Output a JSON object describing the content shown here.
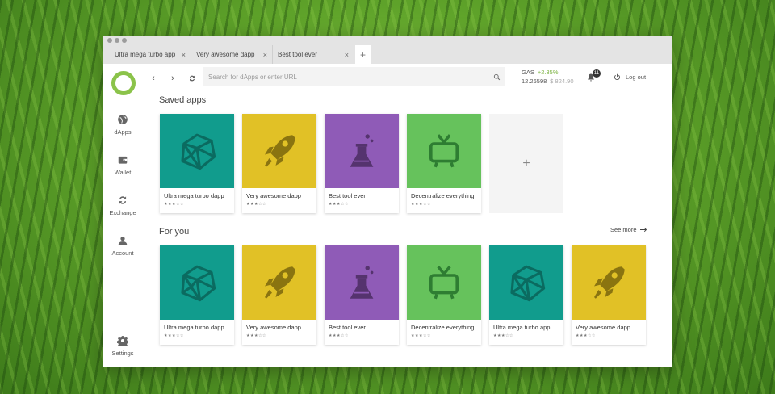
{
  "tabs": [
    {
      "label": "Ultra mega turbo app"
    },
    {
      "label": "Very awesome dapp"
    },
    {
      "label": "Best tool ever"
    }
  ],
  "tab_close_glyph": "×",
  "tab_add_glyph": "+",
  "sidebar": {
    "items": [
      {
        "label": "dApps",
        "icon": "globe-icon"
      },
      {
        "label": "Wallet",
        "icon": "wallet-icon"
      },
      {
        "label": "Exchange",
        "icon": "exchange-icon"
      },
      {
        "label": "Account",
        "icon": "account-icon"
      },
      {
        "label": "Settings",
        "icon": "gear-icon"
      }
    ]
  },
  "toolbar": {
    "back_glyph": "‹",
    "forward_glyph": "›",
    "search_placeholder": "Search for dApps or enter URL"
  },
  "gas": {
    "label": "GAS",
    "change": "+2.35%",
    "amount": "12.26598",
    "usd": "$ 824.90"
  },
  "notifications": {
    "count": "11"
  },
  "logout": {
    "label": "Log out"
  },
  "saved_apps": {
    "title": "Saved apps",
    "add_glyph": "+",
    "items": [
      {
        "name": "Ultra mega turbo dapp",
        "stars": "★★★☆☆",
        "color": "#119c8d",
        "icon": "polyhedron-icon"
      },
      {
        "name": "Very awesome dapp",
        "stars": "★★★☆☆",
        "color": "#e1c126",
        "icon": "rocket-icon"
      },
      {
        "name": "Best tool ever",
        "stars": "★★★☆☆",
        "color": "#8f5bb7",
        "icon": "flask-icon"
      },
      {
        "name": "Decentralize everything",
        "stars": "★★★☆☆",
        "color": "#66c25c",
        "icon": "tv-icon"
      }
    ]
  },
  "for_you": {
    "title": "For you",
    "see_more": "See more",
    "items": [
      {
        "name": "Ultra mega turbo dapp",
        "stars": "★★★☆☆",
        "color": "#119c8d",
        "icon": "polyhedron-icon"
      },
      {
        "name": "Very awesome dapp",
        "stars": "★★★☆☆",
        "color": "#e1c126",
        "icon": "rocket-icon"
      },
      {
        "name": "Best tool ever",
        "stars": "★★★☆☆",
        "color": "#8f5bb7",
        "icon": "flask-icon"
      },
      {
        "name": "Decentralize everything",
        "stars": "★★★☆☆",
        "color": "#66c25c",
        "icon": "tv-icon"
      },
      {
        "name": "Ultra mega turbo app",
        "stars": "★★★☆☆",
        "color": "#119c8d",
        "icon": "polyhedron-icon"
      },
      {
        "name": "Very awesome dapp",
        "stars": "★★★☆☆",
        "color": "#e1c126",
        "icon": "rocket-icon"
      }
    ]
  }
}
